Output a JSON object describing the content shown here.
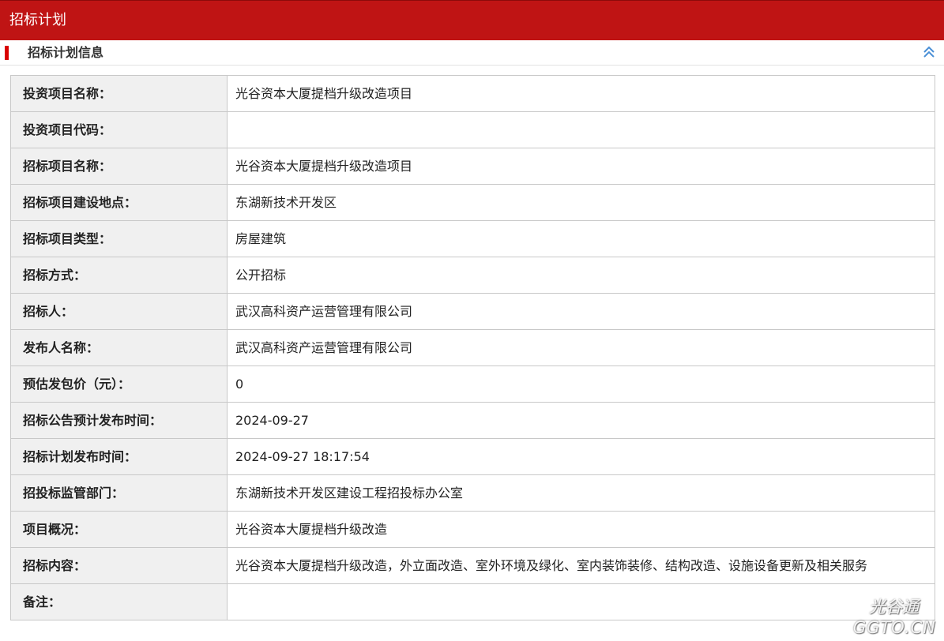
{
  "header": {
    "title": "招标计划"
  },
  "section": {
    "label": "招标计划信息",
    "collapse_icon": "double-chevron-up-icon",
    "accent_color": "#d90000"
  },
  "colors": {
    "header_bg": "#bf1414",
    "label_cell_bg": "#f0f0f0",
    "border": "#c8c8c8"
  },
  "rows": [
    {
      "label": "投资项目名称：",
      "value": "光谷资本大厦提档升级改造项目"
    },
    {
      "label": "投资项目代码：",
      "value": ""
    },
    {
      "label": "招标项目名称：",
      "value": "光谷资本大厦提档升级改造项目"
    },
    {
      "label": "招标项目建设地点：",
      "value": "东湖新技术开发区"
    },
    {
      "label": "招标项目类型：",
      "value": "房屋建筑"
    },
    {
      "label": "招标方式：",
      "value": "公开招标"
    },
    {
      "label": "招标人：",
      "value": "武汉高科资产运营管理有限公司"
    },
    {
      "label": "发布人名称：",
      "value": "武汉高科资产运营管理有限公司"
    },
    {
      "label": "预估发包价（元）：",
      "value": "0"
    },
    {
      "label": "招标公告预计发布时间：",
      "value": "2024-09-27"
    },
    {
      "label": "招标计划发布时间：",
      "value": "2024-09-27 18:17:54"
    },
    {
      "label": "招投标监管部门：",
      "value": "东湖新技术开发区建设工程招投标办公室"
    },
    {
      "label": "项目概况：",
      "value": "光谷资本大厦提档升级改造"
    },
    {
      "label": "招标内容：",
      "value": "光谷资本大厦提档升级改造，外立面改造、室外环境及绿化、室内装饰装修、结构改造、设施设备更新及相关服务"
    },
    {
      "label": "备注：",
      "value": ""
    }
  ],
  "watermark": {
    "line1": "光谷通",
    "line2": "GGTO.CN"
  }
}
